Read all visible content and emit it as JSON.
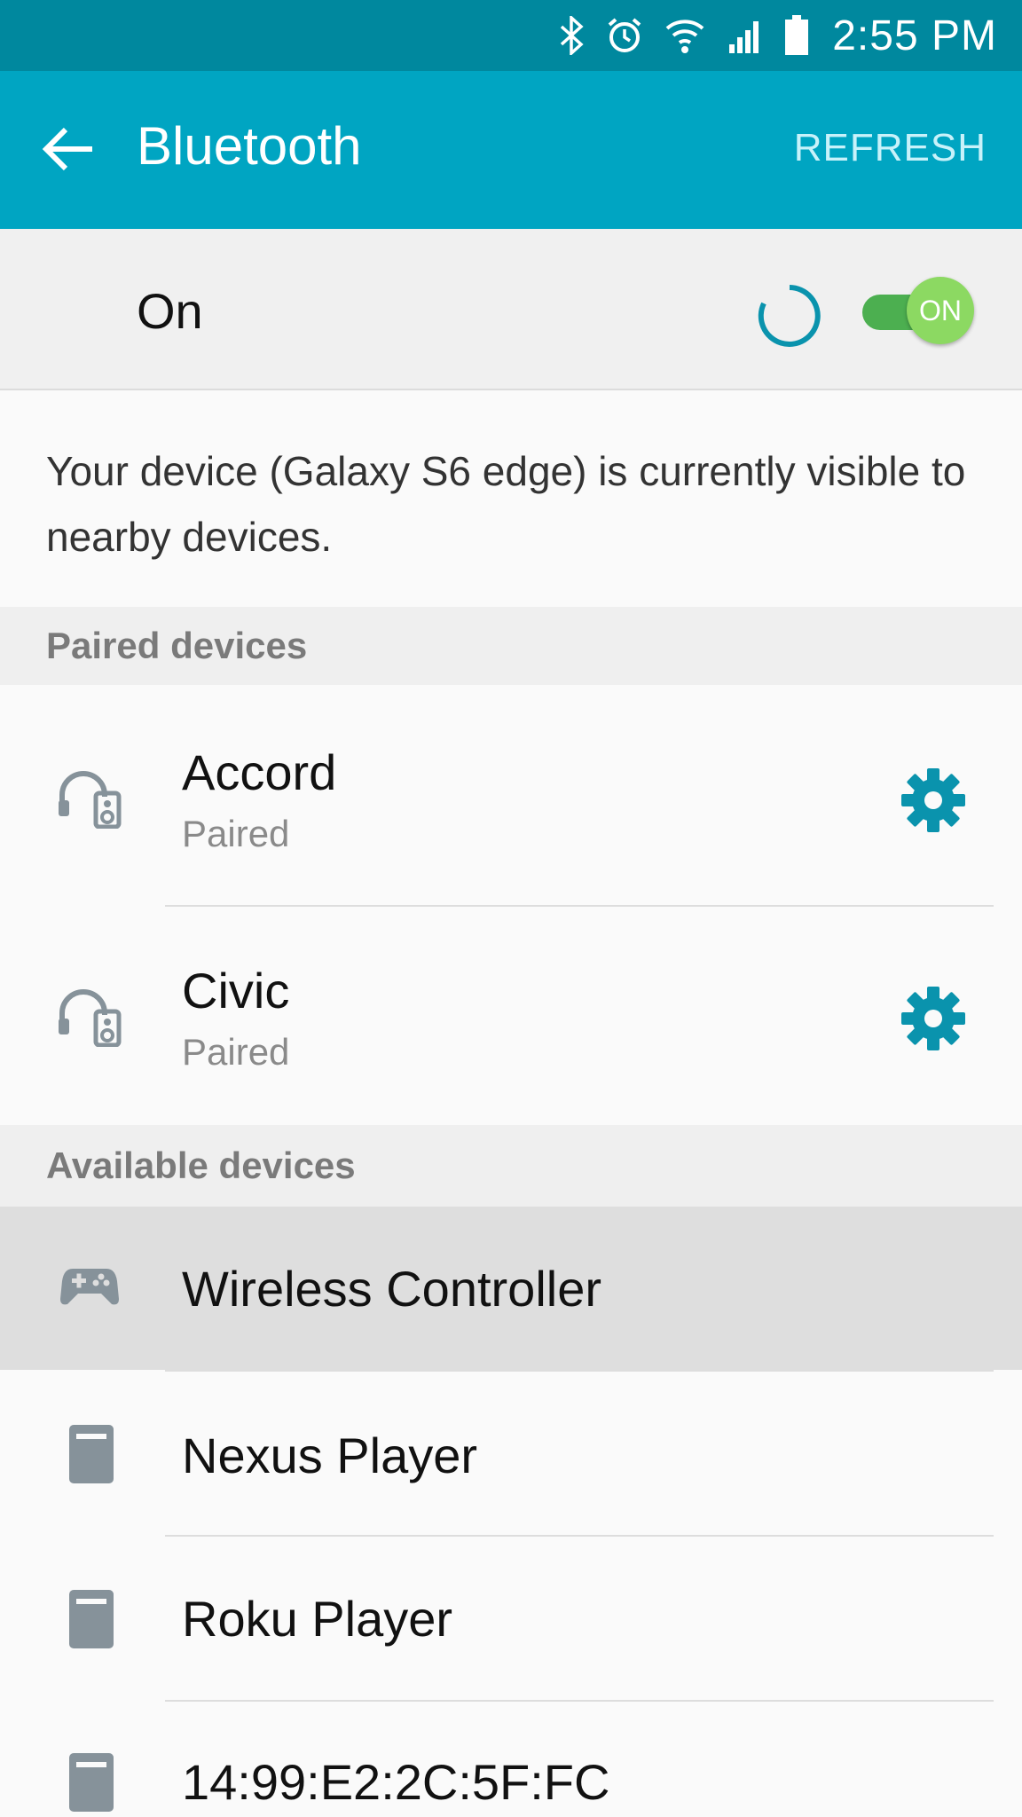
{
  "status_bar": {
    "time": "2:55 PM",
    "icons": [
      "bluetooth-icon",
      "alarm-icon",
      "wifi-icon",
      "signal-icon",
      "battery-icon"
    ]
  },
  "app_bar": {
    "back_icon": "arrow-left-icon",
    "title": "Bluetooth",
    "refresh_label": "REFRESH"
  },
  "bluetooth_toggle": {
    "label": "On",
    "switch_label": "ON",
    "state": true
  },
  "visibility_message": "Your device (Galaxy S6 edge) is currently visible to nearby devices.",
  "paired": {
    "header": "Paired devices",
    "devices": [
      {
        "name": "Accord",
        "status": "Paired",
        "icon": "headset-speaker-icon"
      },
      {
        "name": "Civic",
        "status": "Paired",
        "icon": "headset-speaker-icon"
      }
    ]
  },
  "available": {
    "header": "Available devices",
    "devices": [
      {
        "name": "Wireless Controller",
        "icon": "gamepad-icon"
      },
      {
        "name": "Nexus Player",
        "icon": "device-icon"
      },
      {
        "name": "Roku Player",
        "icon": "device-icon"
      },
      {
        "name": "14:99:E2:2C:5F:FC",
        "icon": "device-icon"
      }
    ]
  },
  "colors": {
    "status_bar": "#00889e",
    "app_bar": "#00a5c2",
    "accent": "#0a93ad",
    "switch_on": "#8cd962"
  }
}
